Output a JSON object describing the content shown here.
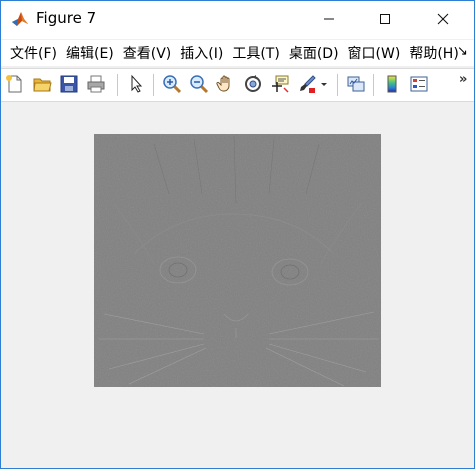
{
  "window": {
    "title": "Figure 7"
  },
  "menu": {
    "items": [
      {
        "label": "文件(F)"
      },
      {
        "label": "编辑(E)"
      },
      {
        "label": "查看(V)"
      },
      {
        "label": "插入(I)"
      },
      {
        "label": "工具(T)"
      },
      {
        "label": "桌面(D)"
      },
      {
        "label": "窗口(W)"
      },
      {
        "label": "帮助(H)"
      }
    ]
  },
  "toolbar": {
    "icons": [
      "new-figure-icon",
      "open-file-icon",
      "save-icon",
      "print-icon",
      "select-pointer-icon",
      "zoom-in-icon",
      "zoom-out-icon",
      "pan-hand-icon",
      "rotate-3d-icon",
      "data-cursor-icon",
      "brush-icon",
      "link-plot-icon",
      "colorbar-icon",
      "legend-icon"
    ]
  },
  "colors": {
    "image_gray": "#808080",
    "window_border": "#2d7fd3",
    "background": "#f0f0f0"
  }
}
